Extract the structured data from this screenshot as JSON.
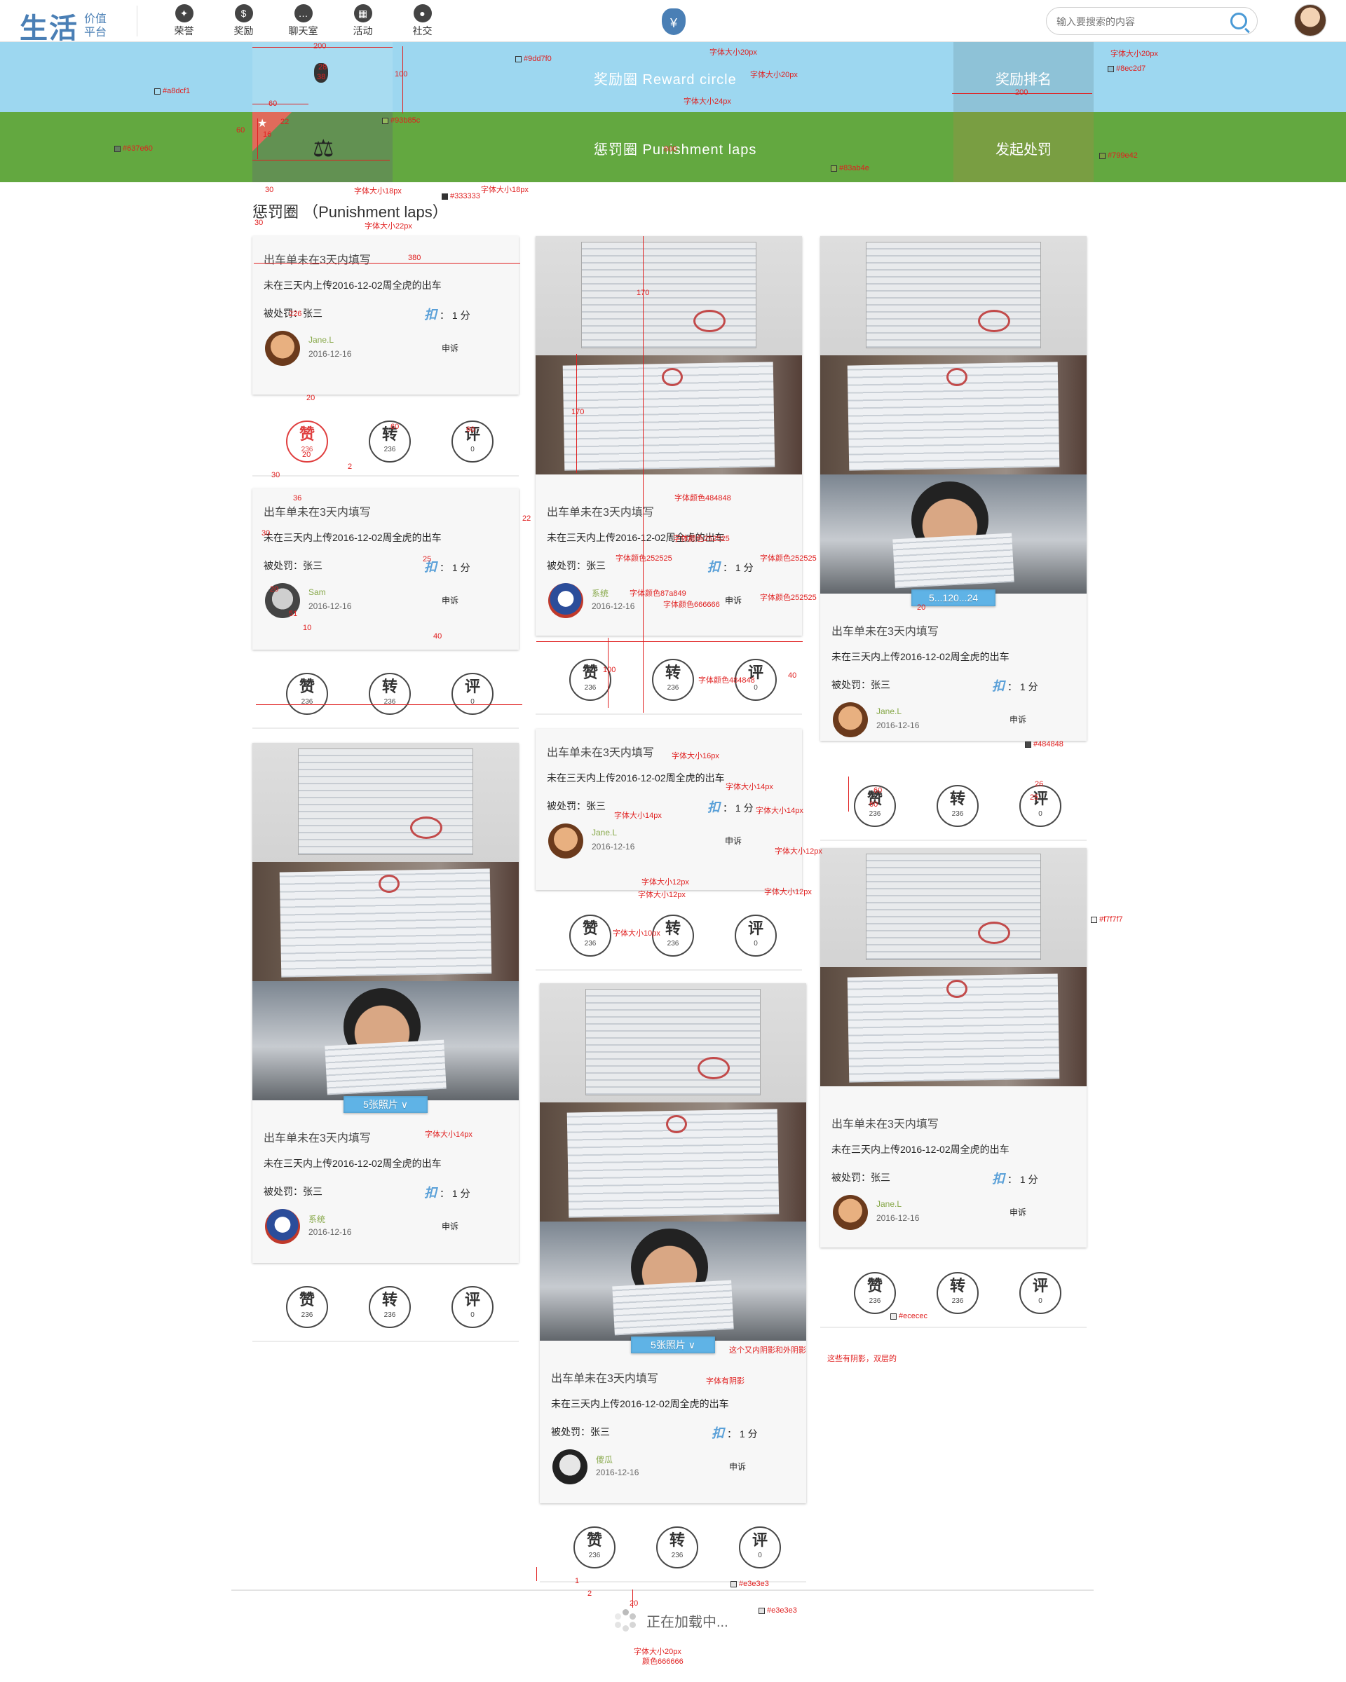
{
  "header": {
    "logo_main": "生活",
    "logo_sub": "价值平台",
    "nav": [
      {
        "label": "荣誉",
        "icon": "medal-icon",
        "glyph": "✦"
      },
      {
        "label": "奖励",
        "icon": "money-bag-icon",
        "glyph": "$"
      },
      {
        "label": "聊天室",
        "icon": "chat-icon",
        "glyph": "…"
      },
      {
        "label": "活动",
        "icon": "calendar-icon",
        "glyph": "▦"
      },
      {
        "label": "社交",
        "icon": "people-icon",
        "glyph": "●"
      }
    ],
    "center_glyph": "¥",
    "search_placeholder": "输入要搜索的内容"
  },
  "bands": {
    "reward_title": "奖励圈 Reward circle",
    "reward_button": "奖励排名",
    "punish_title": "惩罚圈 Punishment laps",
    "punish_button": "发起处罚",
    "punish_icon": "⚖"
  },
  "section_title": "惩罚圈 （Punishment laps）",
  "cards": [
    {
      "title": "出车单未在3天内填写",
      "desc": "未在三天内上传2016-12-02周全虎的出车",
      "penalty": "被处罚：张三",
      "deduct_glyph": "扣",
      "deduct_text": "： 1 分",
      "user": "Jane.L",
      "date": "2016-12-16",
      "appeal": "申诉",
      "likes": "236",
      "shares": "236",
      "comments": "0"
    },
    {
      "title": "出车单未在3天内填写",
      "desc": "未在三天内上传2016-12-02周全虎的出车",
      "penalty": "被处罚：张三",
      "deduct_glyph": "扣",
      "deduct_text": "： 1 分",
      "user": "Sam",
      "date": "2016-12-16",
      "appeal": "申诉",
      "likes": "236",
      "shares": "236",
      "comments": "0"
    },
    {
      "title": "出车单未在3天内填写",
      "desc": "未在三天内上传2016-12-02周全虎的出车",
      "penalty": "被处罚：张三",
      "deduct_glyph": "扣",
      "deduct_text": "： 1 分",
      "user": "系统",
      "date": "2016-12-16",
      "appeal": "申诉",
      "likes": "236",
      "shares": "236",
      "comments": "0",
      "more": "5张照片 ∨"
    },
    {
      "title": "出车单未在3天内填写",
      "desc": "未在三天内上传2016-12-02周全虎的出车",
      "penalty": "被处罚：张三",
      "deduct_glyph": "扣",
      "deduct_text": "： 1 分",
      "user": "系统",
      "date": "2016-12-16",
      "appeal": "申诉",
      "likes": "236",
      "shares": "236",
      "comments": "0"
    },
    {
      "title": "出车单未在3天内填写",
      "desc": "未在三天内上传2016-12-02周全虎的出车",
      "penalty": "被处罚：张三",
      "deduct_glyph": "扣",
      "deduct_text": "： 1 分",
      "user": "Jane.L",
      "date": "2016-12-16",
      "appeal": "申诉",
      "likes": "236",
      "shares": "236",
      "comments": "0"
    },
    {
      "title": "出车单未在3天内填写",
      "desc": "未在三天内上传2016-12-02周全虎的出车",
      "penalty": "被处罚：张三",
      "deduct_glyph": "扣",
      "deduct_text": "： 1 分",
      "user": "傻瓜",
      "date": "2016-12-16",
      "appeal": "申诉",
      "likes": "236",
      "shares": "236",
      "comments": "0",
      "more": "5张照片 ∨"
    },
    {
      "title": "出车单未在3天内填写",
      "desc": "未在三天内上传2016-12-02周全虎的出车",
      "penalty": "被处罚：张三",
      "deduct_glyph": "扣",
      "deduct_text": "： 1 分",
      "user": "Jane.L",
      "date": "2016-12-16",
      "appeal": "申诉",
      "likes": "236",
      "shares": "236",
      "comments": "0",
      "more": "5...120...24"
    },
    {
      "title": "出车单未在3天内填写",
      "desc": "未在三天内上传2016-12-02周全虎的出车",
      "penalty": "被处罚：张三",
      "deduct_glyph": "扣",
      "deduct_text": "： 1 分",
      "user": "Jane.L",
      "date": "2016-12-16",
      "appeal": "申诉",
      "likes": "236",
      "shares": "236",
      "comments": "0"
    }
  ],
  "action_glyphs": {
    "like": "赞",
    "share": "转",
    "comment": "评"
  },
  "loading_text": "正在加载中...",
  "colors": {
    "reward_band": "#9dd7f0",
    "reward_selected": "#a8dcf1",
    "reward_button": "#8ec2d7",
    "punish_band": "#63a840",
    "punish_selected": "#637e60",
    "punish_button": "#799e42",
    "title_text": "#333333",
    "card_bg": "#f7f7f7",
    "divider": "#ececec",
    "line": "#e3e3e3",
    "user_name": "#87a849",
    "date": "#666666",
    "body_text": "#252525",
    "title": "#484848"
  },
  "annotations": [
    {
      "t": "字体大小20px"
    },
    {
      "t": "字体大小20px"
    },
    {
      "t": "字体大小24px"
    },
    {
      "t": "#9dd7f0"
    },
    {
      "t": "#a8dcf1"
    },
    {
      "t": "#93b85c"
    },
    {
      "t": "#637e60"
    },
    {
      "t": "#8ec2d7"
    },
    {
      "t": "#799e42"
    },
    {
      "t": "#83ab4e"
    },
    {
      "t": "字体大小18px"
    },
    {
      "t": "字体大小18px"
    },
    {
      "t": "#333333"
    },
    {
      "t": "字体大小22px"
    },
    {
      "t": "字体大小20px"
    },
    {
      "t": "字体颜色484848"
    },
    {
      "t": "字体颜色252525"
    },
    {
      "t": "字体颜色252525"
    },
    {
      "t": "字体颜色252525"
    },
    {
      "t": "字体颜色87a849"
    },
    {
      "t": "字体颜色666666"
    },
    {
      "t": "字体颜色252525"
    },
    {
      "t": "字体颜色484848"
    },
    {
      "t": "#484848"
    },
    {
      "t": "字体大小16px"
    },
    {
      "t": "字体大小14px"
    },
    {
      "t": "字体大小14px"
    },
    {
      "t": "字体大小14px"
    },
    {
      "t": "字体大小12px"
    },
    {
      "t": "字体大小12px"
    },
    {
      "t": "字体大小12px"
    },
    {
      "t": "字体大小12px"
    },
    {
      "t": "字体大小10px"
    },
    {
      "t": "#f7f7f7"
    },
    {
      "t": "字体大小14px"
    },
    {
      "t": "这个又内阴影和外阴影"
    },
    {
      "t": "字体有阴影"
    },
    {
      "t": "这些有阴影，双层的"
    },
    {
      "t": "#ececec"
    },
    {
      "t": "#e3e3e3"
    },
    {
      "t": "#e3e3e3"
    },
    {
      "t": "字体大小20px"
    },
    {
      "t": "颜色666666"
    }
  ],
  "measures": [
    "200",
    "28",
    "38",
    "100",
    "60",
    "60",
    "22",
    "16",
    "800",
    "200",
    "30",
    "30",
    "380",
    "226",
    "170",
    "170",
    "20",
    "60",
    "60",
    "20",
    "2",
    "30",
    "36",
    "30",
    "25",
    "20",
    "51",
    "10",
    "22",
    "40",
    "100",
    "40",
    "60",
    "60",
    "25",
    "26",
    "20",
    "1",
    "2",
    "20"
  ]
}
